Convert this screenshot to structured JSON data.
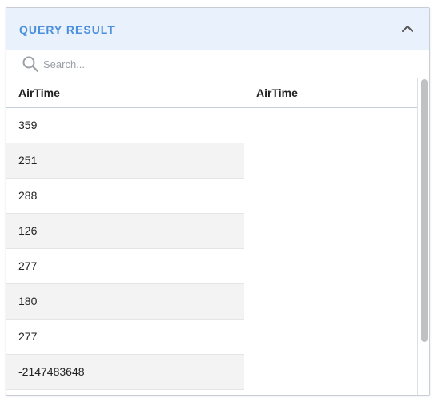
{
  "panel": {
    "title": "QUERY RESULT",
    "collapse_icon": "chevron-up-icon",
    "accent_color": "#4a8fdc",
    "header_bg": "#e9f1fd"
  },
  "search": {
    "placeholder": "Search...",
    "value": "",
    "icon": "search-icon"
  },
  "table": {
    "columns": [
      "AirTime",
      "AirTime"
    ],
    "rows": [
      [
        "359"
      ],
      [
        "251"
      ],
      [
        "288"
      ],
      [
        "126"
      ],
      [
        "277"
      ],
      [
        "180"
      ],
      [
        "277"
      ],
      [
        "-2147483648"
      ]
    ]
  }
}
